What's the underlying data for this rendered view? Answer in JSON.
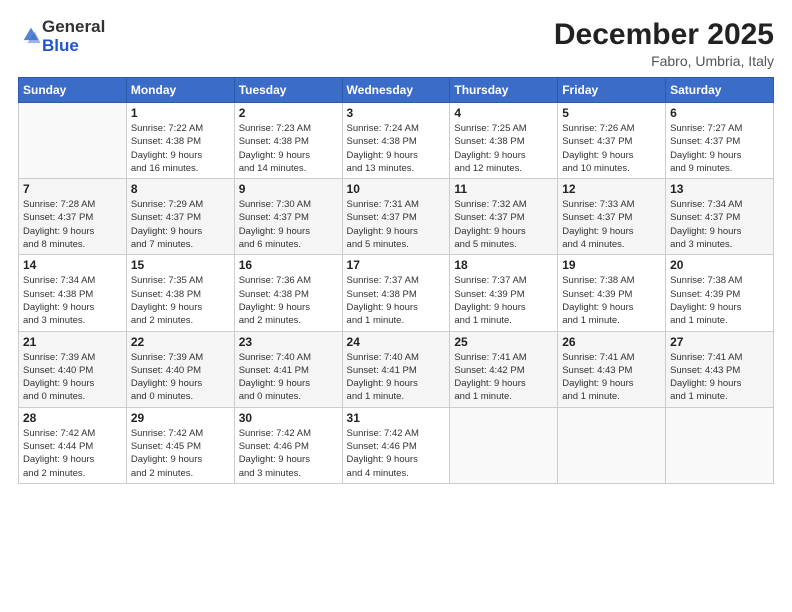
{
  "header": {
    "logo_general": "General",
    "logo_blue": "Blue",
    "month": "December 2025",
    "location": "Fabro, Umbria, Italy"
  },
  "days_of_week": [
    "Sunday",
    "Monday",
    "Tuesday",
    "Wednesday",
    "Thursday",
    "Friday",
    "Saturday"
  ],
  "weeks": [
    {
      "days": [
        {
          "num": "",
          "info": ""
        },
        {
          "num": "1",
          "info": "Sunrise: 7:22 AM\nSunset: 4:38 PM\nDaylight: 9 hours\nand 16 minutes."
        },
        {
          "num": "2",
          "info": "Sunrise: 7:23 AM\nSunset: 4:38 PM\nDaylight: 9 hours\nand 14 minutes."
        },
        {
          "num": "3",
          "info": "Sunrise: 7:24 AM\nSunset: 4:38 PM\nDaylight: 9 hours\nand 13 minutes."
        },
        {
          "num": "4",
          "info": "Sunrise: 7:25 AM\nSunset: 4:38 PM\nDaylight: 9 hours\nand 12 minutes."
        },
        {
          "num": "5",
          "info": "Sunrise: 7:26 AM\nSunset: 4:37 PM\nDaylight: 9 hours\nand 10 minutes."
        },
        {
          "num": "6",
          "info": "Sunrise: 7:27 AM\nSunset: 4:37 PM\nDaylight: 9 hours\nand 9 minutes."
        }
      ]
    },
    {
      "days": [
        {
          "num": "7",
          "info": "Sunrise: 7:28 AM\nSunset: 4:37 PM\nDaylight: 9 hours\nand 8 minutes."
        },
        {
          "num": "8",
          "info": "Sunrise: 7:29 AM\nSunset: 4:37 PM\nDaylight: 9 hours\nand 7 minutes."
        },
        {
          "num": "9",
          "info": "Sunrise: 7:30 AM\nSunset: 4:37 PM\nDaylight: 9 hours\nand 6 minutes."
        },
        {
          "num": "10",
          "info": "Sunrise: 7:31 AM\nSunset: 4:37 PM\nDaylight: 9 hours\nand 5 minutes."
        },
        {
          "num": "11",
          "info": "Sunrise: 7:32 AM\nSunset: 4:37 PM\nDaylight: 9 hours\nand 5 minutes."
        },
        {
          "num": "12",
          "info": "Sunrise: 7:33 AM\nSunset: 4:37 PM\nDaylight: 9 hours\nand 4 minutes."
        },
        {
          "num": "13",
          "info": "Sunrise: 7:34 AM\nSunset: 4:37 PM\nDaylight: 9 hours\nand 3 minutes."
        }
      ]
    },
    {
      "days": [
        {
          "num": "14",
          "info": "Sunrise: 7:34 AM\nSunset: 4:38 PM\nDaylight: 9 hours\nand 3 minutes."
        },
        {
          "num": "15",
          "info": "Sunrise: 7:35 AM\nSunset: 4:38 PM\nDaylight: 9 hours\nand 2 minutes."
        },
        {
          "num": "16",
          "info": "Sunrise: 7:36 AM\nSunset: 4:38 PM\nDaylight: 9 hours\nand 2 minutes."
        },
        {
          "num": "17",
          "info": "Sunrise: 7:37 AM\nSunset: 4:38 PM\nDaylight: 9 hours\nand 1 minute."
        },
        {
          "num": "18",
          "info": "Sunrise: 7:37 AM\nSunset: 4:39 PM\nDaylight: 9 hours\nand 1 minute."
        },
        {
          "num": "19",
          "info": "Sunrise: 7:38 AM\nSunset: 4:39 PM\nDaylight: 9 hours\nand 1 minute."
        },
        {
          "num": "20",
          "info": "Sunrise: 7:38 AM\nSunset: 4:39 PM\nDaylight: 9 hours\nand 1 minute."
        }
      ]
    },
    {
      "days": [
        {
          "num": "21",
          "info": "Sunrise: 7:39 AM\nSunset: 4:40 PM\nDaylight: 9 hours\nand 0 minutes."
        },
        {
          "num": "22",
          "info": "Sunrise: 7:39 AM\nSunset: 4:40 PM\nDaylight: 9 hours\nand 0 minutes."
        },
        {
          "num": "23",
          "info": "Sunrise: 7:40 AM\nSunset: 4:41 PM\nDaylight: 9 hours\nand 0 minutes."
        },
        {
          "num": "24",
          "info": "Sunrise: 7:40 AM\nSunset: 4:41 PM\nDaylight: 9 hours\nand 1 minute."
        },
        {
          "num": "25",
          "info": "Sunrise: 7:41 AM\nSunset: 4:42 PM\nDaylight: 9 hours\nand 1 minute."
        },
        {
          "num": "26",
          "info": "Sunrise: 7:41 AM\nSunset: 4:43 PM\nDaylight: 9 hours\nand 1 minute."
        },
        {
          "num": "27",
          "info": "Sunrise: 7:41 AM\nSunset: 4:43 PM\nDaylight: 9 hours\nand 1 minute."
        }
      ]
    },
    {
      "days": [
        {
          "num": "28",
          "info": "Sunrise: 7:42 AM\nSunset: 4:44 PM\nDaylight: 9 hours\nand 2 minutes."
        },
        {
          "num": "29",
          "info": "Sunrise: 7:42 AM\nSunset: 4:45 PM\nDaylight: 9 hours\nand 2 minutes."
        },
        {
          "num": "30",
          "info": "Sunrise: 7:42 AM\nSunset: 4:46 PM\nDaylight: 9 hours\nand 3 minutes."
        },
        {
          "num": "31",
          "info": "Sunrise: 7:42 AM\nSunset: 4:46 PM\nDaylight: 9 hours\nand 4 minutes."
        },
        {
          "num": "",
          "info": ""
        },
        {
          "num": "",
          "info": ""
        },
        {
          "num": "",
          "info": ""
        }
      ]
    }
  ]
}
